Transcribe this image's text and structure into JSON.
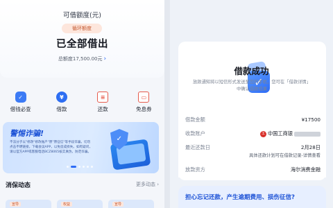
{
  "left": {
    "limit_label": "可借额度(元)",
    "cycle_badge": "循环额度",
    "status": "已全部借出",
    "total_limit": "总额度17,500.00元",
    "quick_actions": [
      {
        "label": "借钱必查",
        "icon": "shield-check-icon"
      },
      {
        "label": "借款",
        "icon": "yuan-coin-icon"
      },
      {
        "label": "还款",
        "icon": "repay-bill-icon"
      },
      {
        "label": "免息券",
        "icon": "coupon-icon"
      }
    ],
    "banner": {
      "title": "警惕诈骗!",
      "text": "不法分子以\"修改\"修改账户\"原\"原征信\"等手段诈骗，切勿点击不明链接，下载会议APP，以免造成损失。如有疑问，请以官方APP或客服电话BCZ8065核实真伪，防范诈骗。",
      "active_slide": 1,
      "slide_count": 6
    },
    "news": {
      "title": "消保动态",
      "more": "更多动态",
      "cards": [
        "宣导",
        "权益",
        "宣导"
      ]
    }
  },
  "right": {
    "title": "借款成功",
    "description": "放款通知将以短信形式发送至您的手机，您可在「借款详情」中确认借款结果",
    "details": [
      {
        "label": "借款金额",
        "value": "¥17500"
      },
      {
        "label": "收款账户",
        "value": "中国工商银"
      },
      {
        "label": "最近还款日",
        "value": "2月28日",
        "note": "具体还款计划可在借款记录-详情查看"
      },
      {
        "label": "放款资方",
        "value": "海尔消费金融"
      }
    ],
    "tip": "担心忘记还款，产生逾期费用、损伤征信?"
  },
  "colors": {
    "accent": "#2e6cf6",
    "warning_badge_bg": "#fde6dc",
    "warning_badge_text": "#c4572e"
  }
}
